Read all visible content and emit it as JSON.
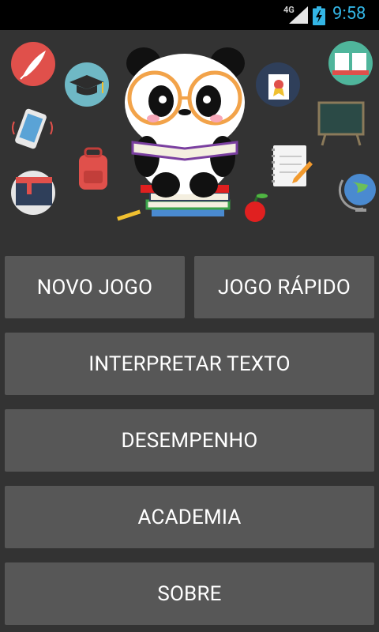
{
  "status_bar": {
    "network": "4G",
    "time": "9:58"
  },
  "menu": {
    "new_game": "NOVO JOGO",
    "quick_game": "JOGO RÁPIDO",
    "interpret_text": "INTERPRETAR TEXTO",
    "performance": "DESEMPENHO",
    "academy": "ACADEMIA",
    "about": "SOBRE"
  },
  "colors": {
    "background": "#333333",
    "button": "#575757",
    "clock": "#33b5e5"
  }
}
